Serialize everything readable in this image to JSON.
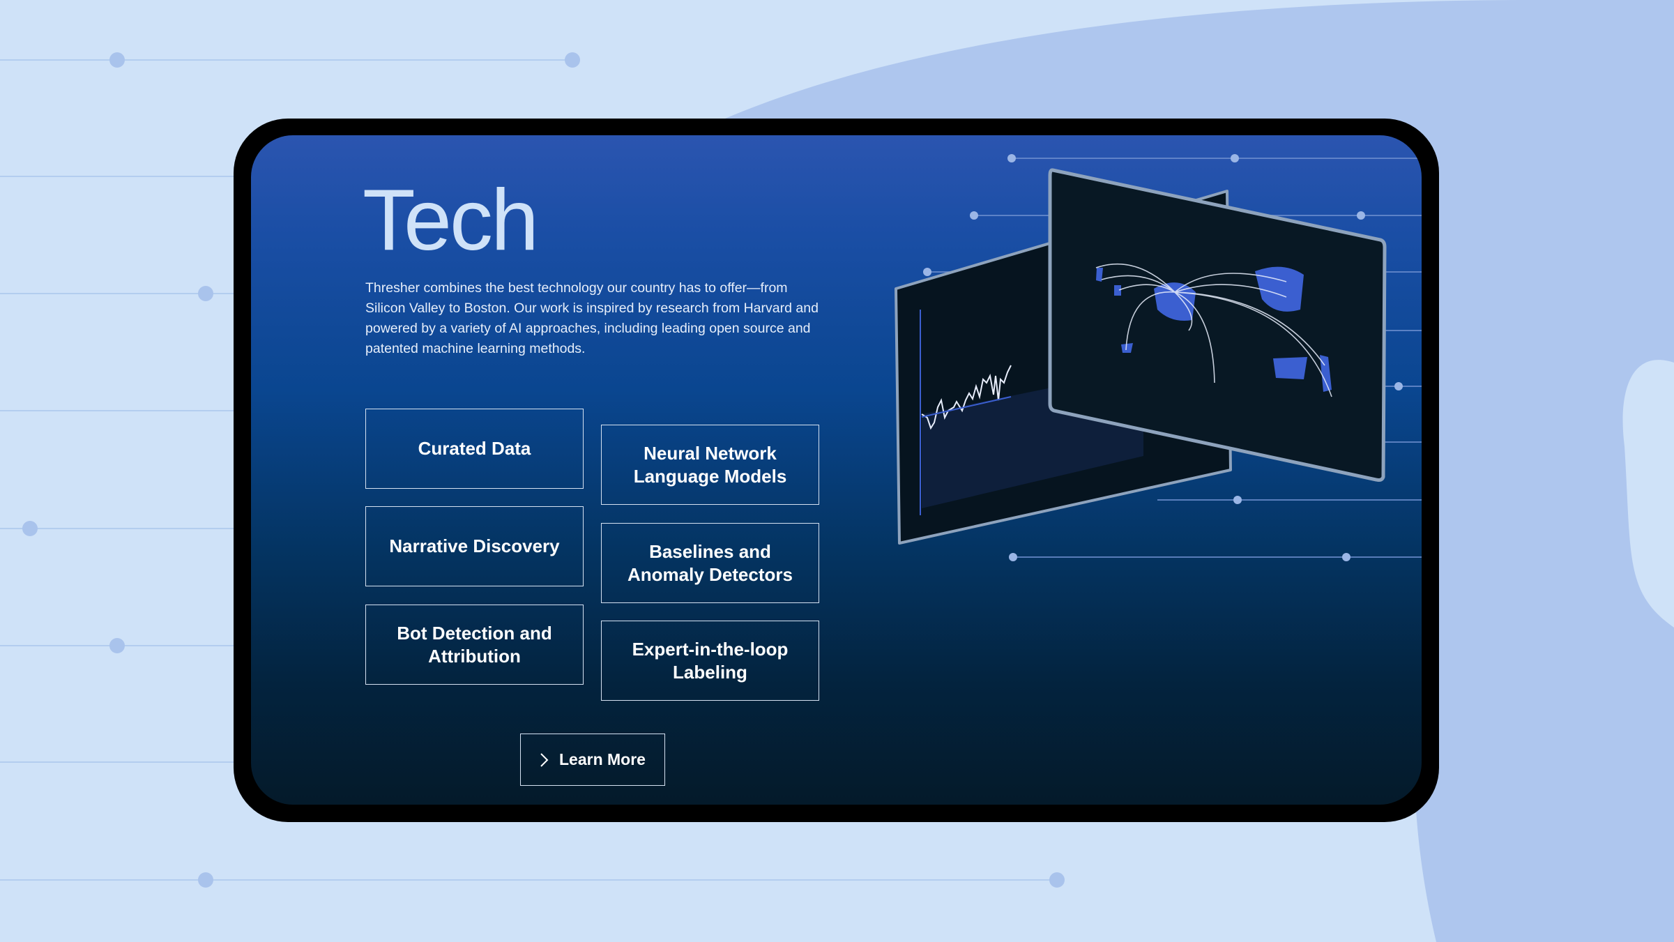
{
  "hero": {
    "title": "Tech",
    "description": "Thresher combines the best technology our country has to offer—from Silicon Valley to Boston. Our work is inspired by research from Harvard and powered by a variety of AI approaches, including leading open source and patented machine learning methods."
  },
  "capabilities": [
    {
      "label": "Curated Data"
    },
    {
      "label": "Neural Network Language Models"
    },
    {
      "label": "Narrative Discovery"
    },
    {
      "label": "Baselines and Anomaly Detectors"
    },
    {
      "label": "Bot Detection and Attribution"
    },
    {
      "label": "Expert-in-the-loop Labeling"
    }
  ],
  "cta": {
    "label": "Learn More",
    "icon": "chevron-right-icon"
  },
  "colors": {
    "background": "#cfe2f8",
    "blob": "#aec6ee",
    "accent": "#3b5fd0",
    "screen_top": "#2b55b0",
    "screen_bottom": "#041a2a"
  }
}
